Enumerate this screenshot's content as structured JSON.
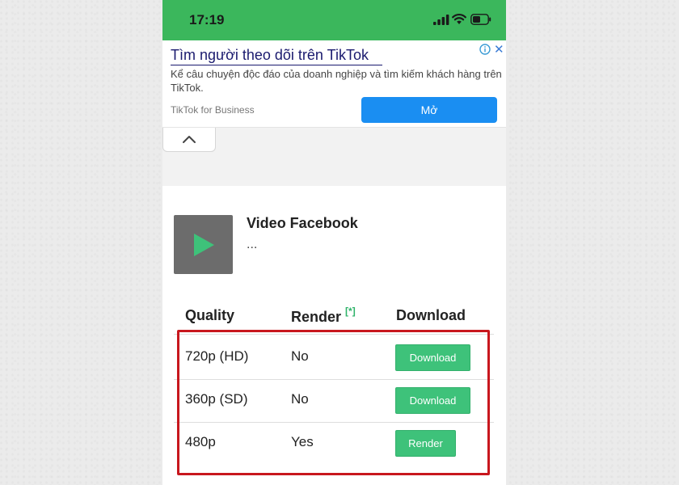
{
  "status_bar": {
    "time": "17:19",
    "color": "#3bb75c"
  },
  "ad": {
    "title": "Tìm người theo dõi trên TikTok",
    "description": "Kể câu chuyện độc đáo của doanh nghiệp và tìm kiếm khách hàng trên TikTok.",
    "brand": "TikTok for Business",
    "open_label": "Mở",
    "icons": [
      "info-icon",
      "close-icon"
    ]
  },
  "video": {
    "title": "Video Facebook",
    "subtitle": "...",
    "thumb_icon": "play-icon"
  },
  "table": {
    "headers": {
      "quality": "Quality",
      "render": "Render",
      "render_note": "[*]",
      "download": "Download"
    },
    "rows": [
      {
        "quality": "720p (HD)",
        "render": "No",
        "action": "Download"
      },
      {
        "quality": "360p (SD)",
        "render": "No",
        "action": "Download"
      },
      {
        "quality": "480p",
        "render": "Yes",
        "action": "Render"
      }
    ]
  },
  "colors": {
    "accent": "#3ec27a",
    "highlight_border": "#c8171e",
    "ad_button": "#1a8ef2"
  }
}
